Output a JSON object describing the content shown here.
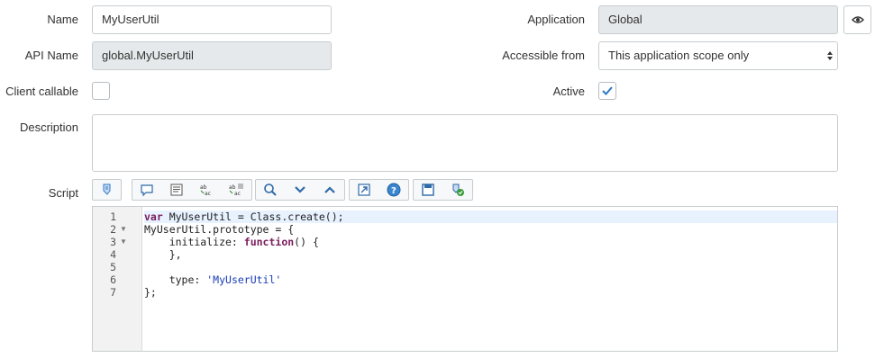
{
  "form": {
    "name": {
      "label": "Name",
      "value": "MyUserUtil"
    },
    "api_name": {
      "label": "API Name",
      "value": "global.MyUserUtil"
    },
    "client_callable": {
      "label": "Client callable",
      "checked": false
    },
    "description": {
      "label": "Description",
      "value": ""
    },
    "application": {
      "label": "Application",
      "value": "Global"
    },
    "accessible_from": {
      "label": "Accessible from",
      "value": "This application scope only"
    },
    "active": {
      "label": "Active",
      "checked": true
    },
    "script": {
      "label": "Script"
    }
  },
  "toolbar": {
    "buttons": [
      "toggle-syntax-icon",
      "comment-icon",
      "format-code-icon",
      "replace-icon",
      "replace-all-icon",
      "search-icon",
      "chevron-down-icon",
      "chevron-up-icon",
      "fullscreen-icon",
      "help-icon",
      "save-icon",
      "script-debugger-icon"
    ]
  },
  "editor": {
    "line_numbers": [
      "1",
      "2",
      "3",
      "4",
      "5",
      "6",
      "7"
    ],
    "fold_markers": [
      "",
      "▼",
      "▼",
      "",
      "",
      "",
      ""
    ],
    "lines": [
      [
        {
          "t": "var",
          "c": "kw"
        },
        {
          "t": " MyUserUtil = Class.create();",
          "c": ""
        }
      ],
      [
        {
          "t": "MyUserUtil.prototype = {",
          "c": ""
        }
      ],
      [
        {
          "t": "    initialize: ",
          "c": ""
        },
        {
          "t": "function",
          "c": "kw"
        },
        {
          "t": "() {",
          "c": ""
        }
      ],
      [
        {
          "t": "    },",
          "c": ""
        }
      ],
      [
        {
          "t": "",
          "c": ""
        }
      ],
      [
        {
          "t": "    type: ",
          "c": ""
        },
        {
          "t": "'MyUserUtil'",
          "c": "str"
        }
      ],
      [
        {
          "t": "};",
          "c": ""
        }
      ]
    ]
  },
  "colors": {
    "accent": "#2e78c7",
    "readonly_bg": "#e6e9eb",
    "keyword": "#7a1c5c",
    "string": "#1a3db8"
  }
}
